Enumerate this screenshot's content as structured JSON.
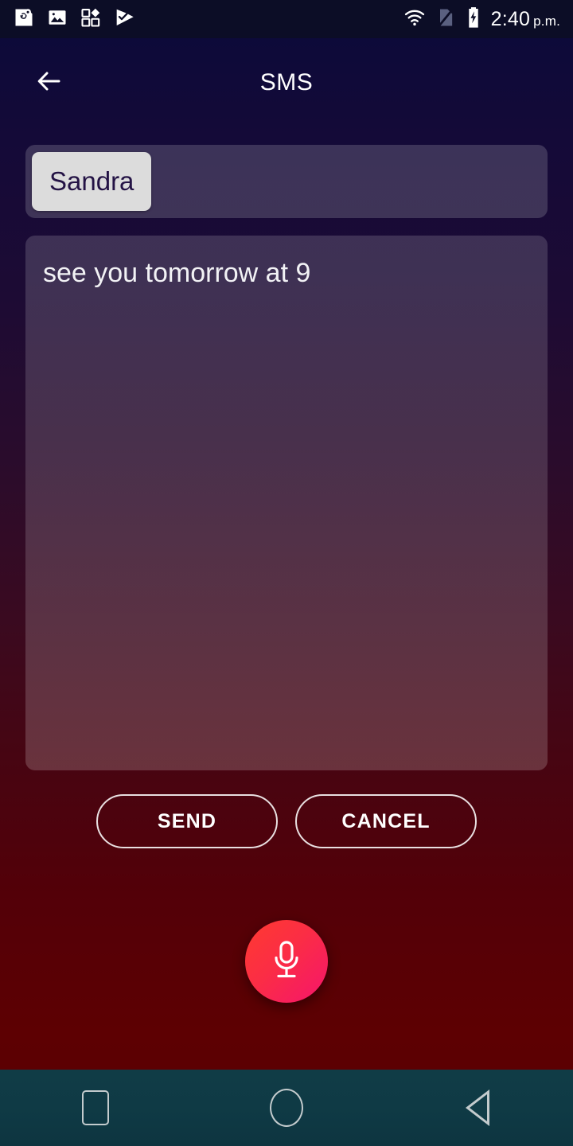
{
  "statusbar": {
    "time": "2:40",
    "ampm": "p.m.",
    "left_icons": [
      {
        "name": "google-maps-icon"
      },
      {
        "name": "photos-icon"
      },
      {
        "name": "apps-grid-icon"
      },
      {
        "name": "checkmark-flag-icon"
      }
    ],
    "right_icons": [
      {
        "name": "wifi-icon"
      },
      {
        "name": "no-sim-icon"
      },
      {
        "name": "battery-charging-icon"
      }
    ],
    "background": "#0c0d26"
  },
  "titlebar": {
    "title": "SMS",
    "back_icon": "arrow-left-icon"
  },
  "compose": {
    "recipient": {
      "chip_label": "Sandra",
      "chip_bg": "#dcdcdc",
      "chip_text_color": "#241345"
    },
    "message": {
      "value": "see you tomorrow at 9",
      "placeholder": ""
    }
  },
  "actions": {
    "send_label": "SEND",
    "cancel_label": "CANCEL"
  },
  "fab": {
    "icon": "microphone-icon",
    "color_start": "#ff3a30",
    "color_end": "#f5156c"
  },
  "navbar": {
    "recents_icon": "square-recents-icon",
    "home_icon": "circle-home-icon",
    "back_icon": "triangle-back-icon",
    "background": "#103c46"
  },
  "theme": {
    "gradient_top": "#0a0a3a",
    "gradient_mid": "#2a0c2c",
    "gradient_bottom": "#5a0003"
  }
}
